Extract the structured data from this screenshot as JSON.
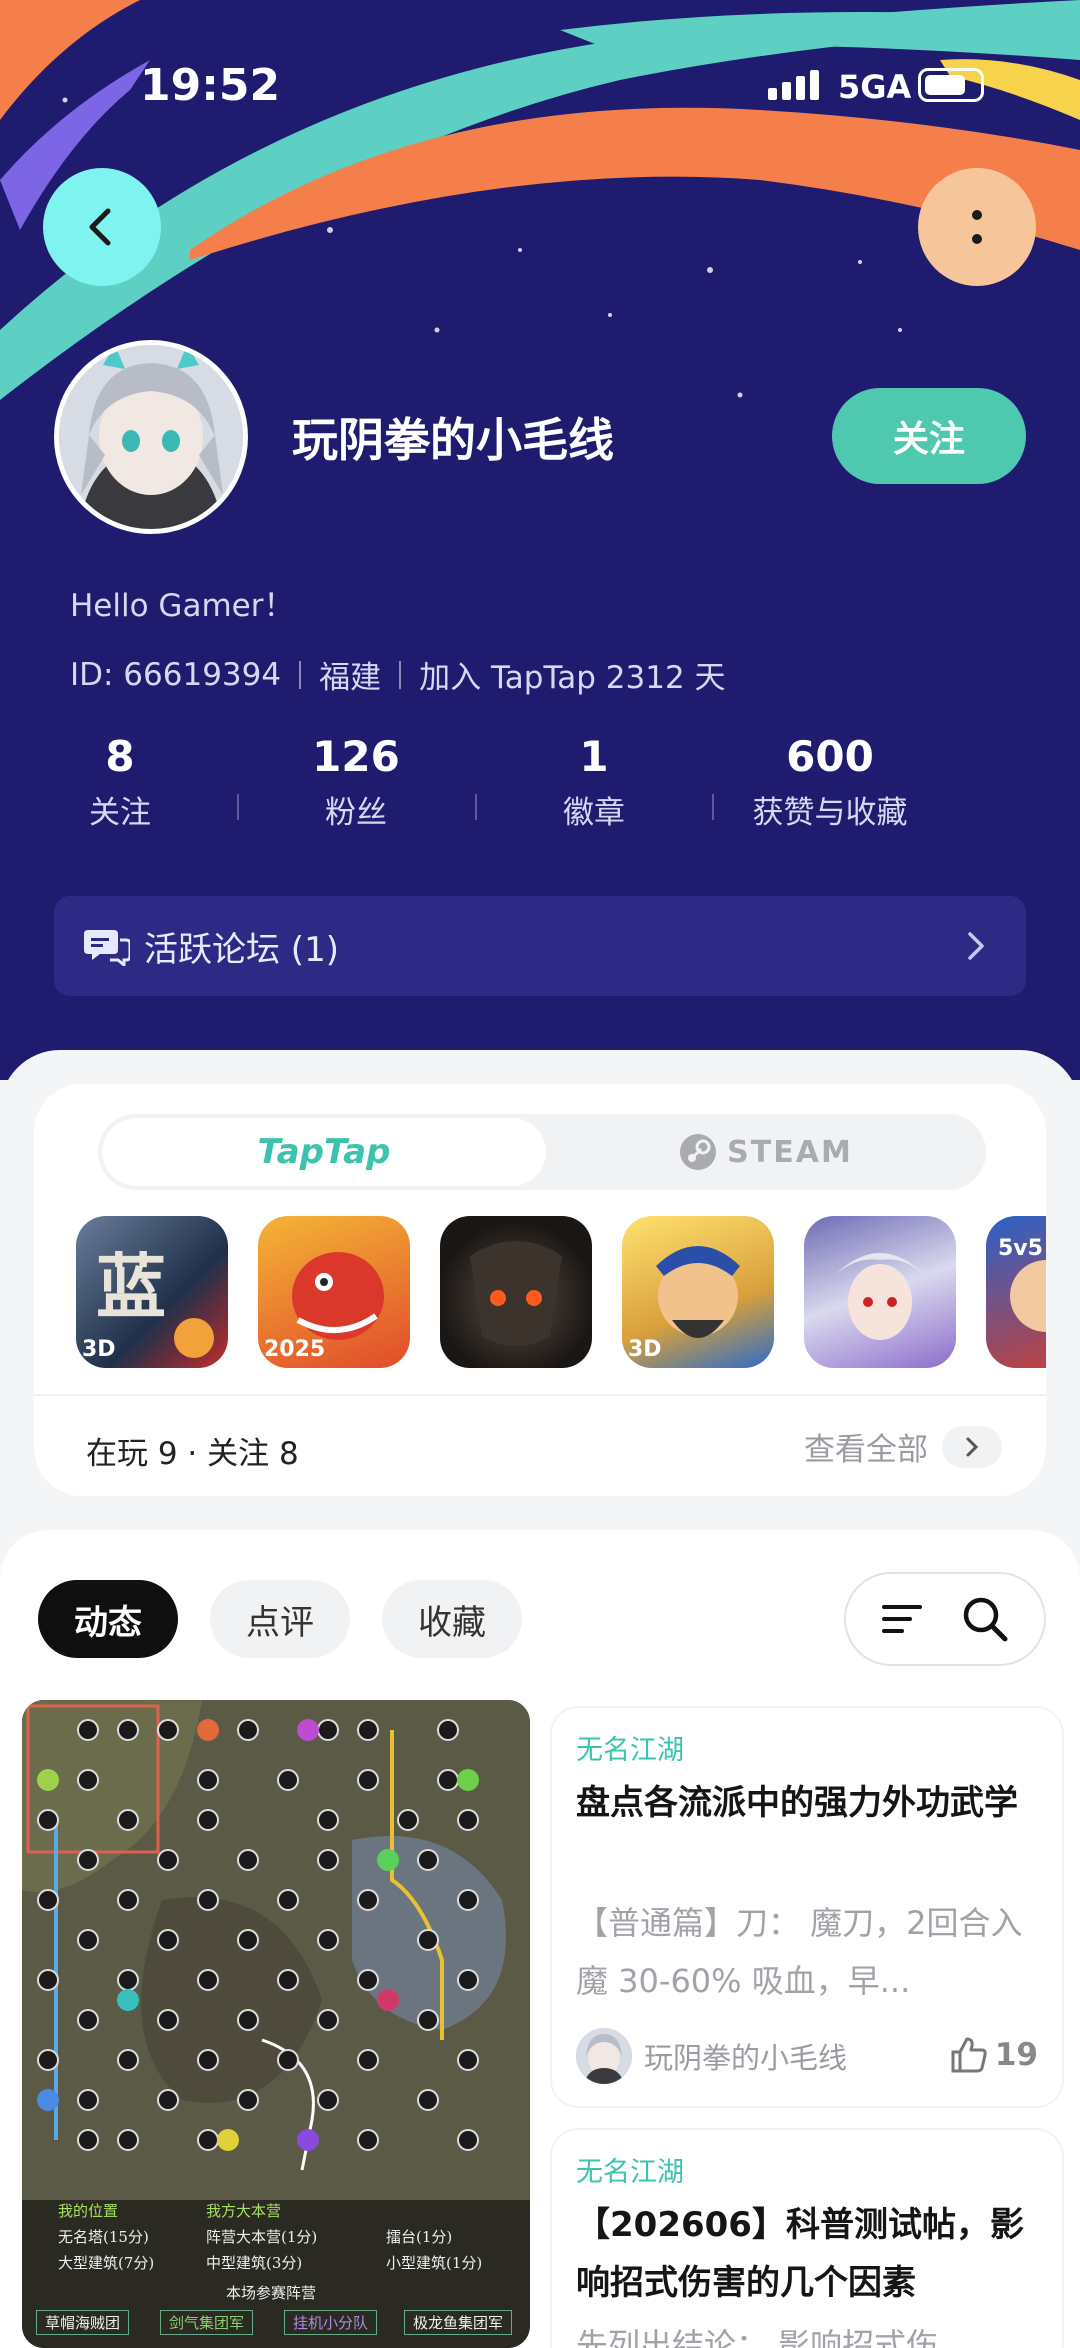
{
  "status_bar": {
    "time": "19:52",
    "network": "5GA"
  },
  "profile": {
    "username": "玩阴拳的小毛线",
    "follow_label": "关注",
    "bio": "Hello Gamer！",
    "id_text": "ID: 66619394",
    "region": "福建",
    "joined": "加入 TapTap 2312 天"
  },
  "stats": [
    {
      "value": "8",
      "label": "关注"
    },
    {
      "value": "126",
      "label": "粉丝"
    },
    {
      "value": "1",
      "label": "徽章"
    },
    {
      "value": "600",
      "label": "获赞与收藏"
    }
  ],
  "forum": {
    "label": "活跃论坛 (1)"
  },
  "games": {
    "platform_tabs": [
      "TapTap",
      "STEAM"
    ],
    "active_platform": "TapTap",
    "icon_tags": [
      "3D",
      "2025",
      "",
      "3D",
      "",
      "5v5"
    ],
    "summary": "在玩 9 · 关注 8",
    "see_all": "查看全部"
  },
  "feed": {
    "tabs": [
      "动态",
      "点评",
      "收藏"
    ],
    "active_tab": "动态",
    "posts": [
      {
        "category": "无名江湖",
        "title": "盘点各流派中的强力外功武学",
        "excerpt": "【普通篇】刀：  魔刀，2回合入魔 30-60% 吸血，早...",
        "author": "玩阴拳的小毛线",
        "likes": "19"
      },
      {
        "category": "无名江湖",
        "title": "【202606】科普测试帖，影响招式伤害的几个因素",
        "excerpt": "先列出结论：   影响招式伤..."
      }
    ],
    "map_legend": {
      "items": [
        "我的位置",
        "我方大本营",
        "无名塔(15分)",
        "阵营大本营(1分)",
        "擂台(1分)",
        "大型建筑(7分)",
        "中型建筑(3分)",
        "小型建筑(1分)"
      ],
      "caption": "本场参赛阵营",
      "factions": [
        "草帽海贼团",
        "剑气集团军",
        "挂机小分队",
        "极龙鱼集团军"
      ]
    }
  },
  "colors": {
    "header_bg": "#1f1b6f",
    "accent": "#4ec9b0",
    "feed_category": "#3cc3ad"
  }
}
